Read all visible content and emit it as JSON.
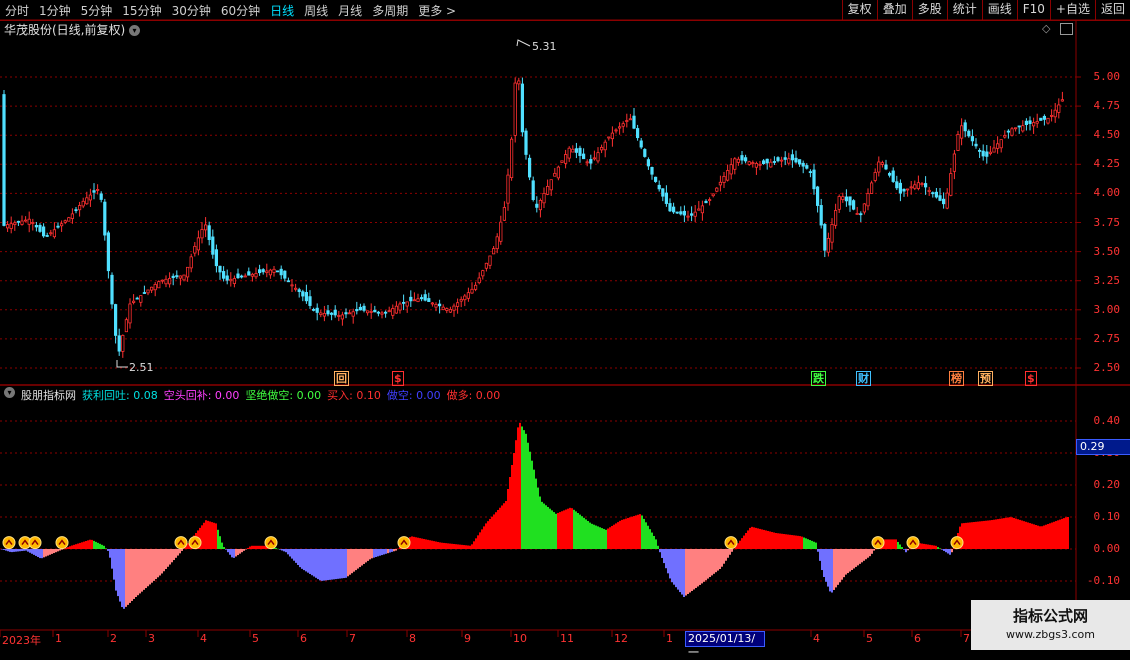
{
  "toolbar": {
    "tabs": [
      {
        "label": "分时"
      },
      {
        "label": "1分钟"
      },
      {
        "label": "5分钟"
      },
      {
        "label": "15分钟"
      },
      {
        "label": "30分钟"
      },
      {
        "label": "60分钟"
      },
      {
        "label": "日线"
      },
      {
        "label": "周线"
      },
      {
        "label": "月线"
      },
      {
        "label": "多周期"
      },
      {
        "label": "更多 >"
      }
    ],
    "active_tab": "日线",
    "buttons": [
      {
        "label": "复权"
      },
      {
        "label": "叠加"
      },
      {
        "label": "多股"
      },
      {
        "label": "统计"
      },
      {
        "label": "画线"
      },
      {
        "label": "F10"
      },
      {
        "label": "+自选"
      },
      {
        "label": "返回"
      }
    ]
  },
  "stock": {
    "title": "华茂股份(日线,前复权)"
  },
  "price_chart": {
    "axis_labels": [
      "5.00",
      "4.75",
      "4.50",
      "4.25",
      "4.00",
      "3.75",
      "3.50",
      "3.25",
      "3.00",
      "2.75",
      "2.50"
    ],
    "axis_values": [
      5.0,
      4.75,
      4.5,
      4.25,
      4.0,
      3.75,
      3.5,
      3.25,
      3.0,
      2.75,
      2.5
    ],
    "high_label": "5.31",
    "low_label": "2.51",
    "markers": [
      {
        "label": "回",
        "color": "#ffb060"
      },
      {
        "label": "$",
        "color": "#ff3030"
      },
      {
        "label": "跌",
        "color": "#40ff40"
      },
      {
        "label": "财",
        "color": "#40c0ff"
      },
      {
        "label": "榜",
        "color": "#ff8040"
      },
      {
        "label": "预",
        "color": "#ffb060"
      },
      {
        "label": "$",
        "color": "#ff3030"
      }
    ]
  },
  "indicator": {
    "name": "股朋指标网",
    "items": [
      {
        "label": "获利回吐:",
        "value": "0.08",
        "color": "#00e0e0"
      },
      {
        "label": "空头回补:",
        "value": "0.00",
        "color": "#ff40ff"
      },
      {
        "label": "坚绝做空:",
        "value": "0.00",
        "color": "#40ff40"
      },
      {
        "label": "买入:",
        "value": "0.10",
        "color": "#ff3030"
      },
      {
        "label": "做空:",
        "value": "0.00",
        "color": "#4040ff"
      },
      {
        "label": "做多:",
        "value": "0.00",
        "color": "#ff3030"
      }
    ],
    "axis_labels": [
      "0.40",
      "0.30",
      "0.20",
      "0.10",
      "0.00",
      "-0.10"
    ],
    "axis_values": [
      0.4,
      0.3,
      0.2,
      0.1,
      0.0,
      -0.1
    ],
    "current_value": "0.29"
  },
  "date_axis": {
    "labels": [
      "2023年",
      "1",
      "2",
      "3",
      "4",
      "5",
      "6",
      "7",
      "8",
      "9",
      "10",
      "11",
      "12",
      "1",
      "4",
      "5",
      "6",
      "7"
    ],
    "cursor_date": "2025/01/13/一"
  },
  "watermark": {
    "line1": "指标公式网",
    "line2": "www.zbgs3.com"
  },
  "colors": {
    "up": "#ff3030",
    "down": "#50e0ff",
    "grid": "#8b0000",
    "pos_fill": "#ff0000",
    "neg_fill": "#7070ff"
  }
}
